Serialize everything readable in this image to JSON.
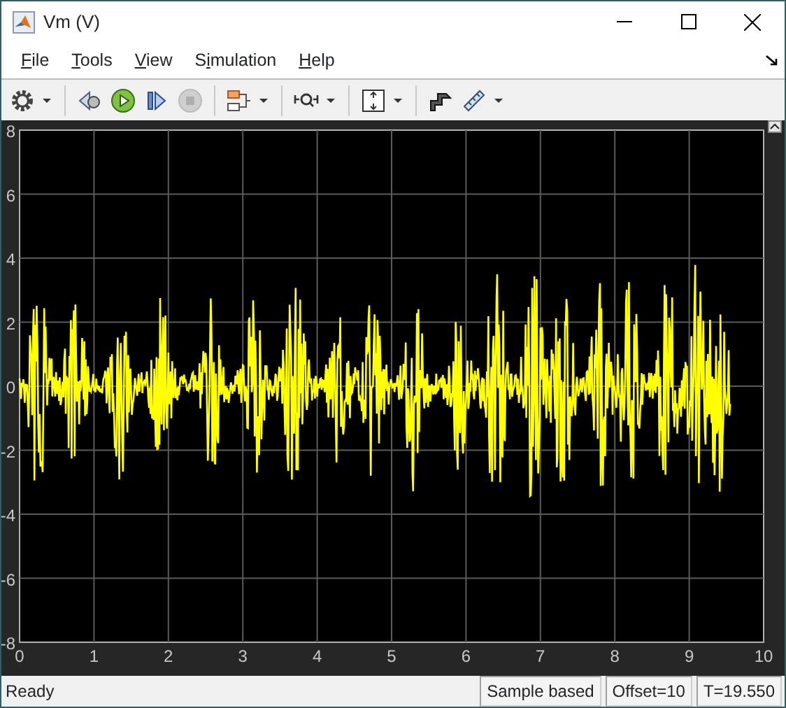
{
  "window": {
    "title": "Vm (V)"
  },
  "menu": [
    {
      "key": "F",
      "after": "ile"
    },
    {
      "key": "T",
      "after": "ools"
    },
    {
      "key": "V",
      "after": "iew"
    },
    {
      "before": "S",
      "key": "i",
      "after": "mulation"
    },
    {
      "key": "H",
      "after": "elp"
    }
  ],
  "toolbar_groups": [
    [
      {
        "kind": "gear",
        "disabled": false,
        "menu": true
      }
    ],
    [
      {
        "kind": "step-back",
        "disabled": false,
        "menu": false
      },
      {
        "kind": "run",
        "disabled": false,
        "menu": false
      },
      {
        "kind": "step-forward",
        "disabled": false,
        "menu": false
      },
      {
        "kind": "stop",
        "disabled": true,
        "menu": false
      }
    ],
    [
      {
        "kind": "blocks",
        "disabled": false,
        "menu": true
      }
    ],
    [
      {
        "kind": "zoom-x",
        "disabled": false,
        "menu": true
      }
    ],
    [
      {
        "kind": "scale",
        "disabled": false,
        "menu": true
      }
    ],
    [
      {
        "kind": "highlight",
        "disabled": false,
        "menu": false
      },
      {
        "kind": "ruler",
        "disabled": false,
        "menu": true
      }
    ]
  ],
  "plot": {
    "y_tick_labels": [
      "8",
      "6",
      "4",
      "2",
      "0",
      "-2",
      "-4",
      "-6",
      "-8"
    ],
    "x_tick_labels": [
      "0",
      "1",
      "2",
      "3",
      "4",
      "5",
      "6",
      "7",
      "8",
      "9",
      "10"
    ]
  },
  "status_bar": {
    "message": "Ready",
    "panels": [
      "Sample based",
      "Offset=10",
      "T=19.550"
    ]
  }
}
